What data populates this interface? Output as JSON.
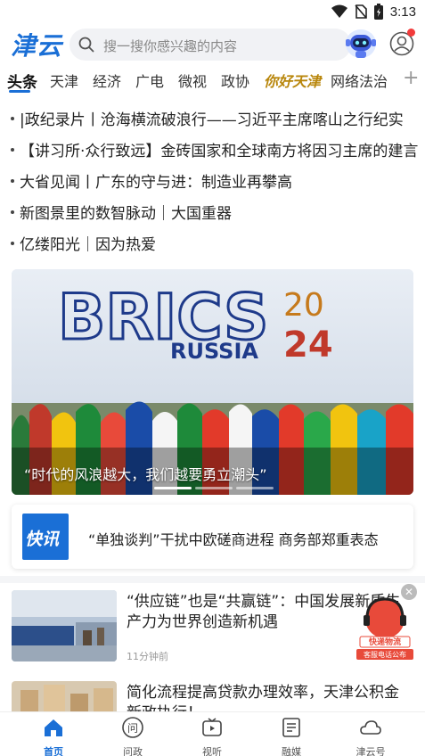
{
  "status": {
    "time": "3:13"
  },
  "header": {
    "logo": "津云",
    "search_placeholder": "搜一搜你感兴趣的内容"
  },
  "tabs": [
    {
      "label": "头条",
      "active": true
    },
    {
      "label": "天津"
    },
    {
      "label": "经济"
    },
    {
      "label": "广电"
    },
    {
      "label": "微视"
    },
    {
      "label": "政协"
    },
    {
      "label": "你好天津",
      "brand": true
    },
    {
      "label": "网络法治"
    }
  ],
  "headlines": [
    "|政纪录片丨沧海横流破浪行——习近平主席喀山之行纪实",
    "【讲习所·众行致远】金砖国家和全球南方将因习主席的建言",
    "大省见闻丨广东的守与进：制造业再攀高",
    "新图景里的数智脉动｜大国重器",
    "亿缕阳光｜因为热爱"
  ],
  "banner": {
    "caption": "“时代的风浪越大，我们越要勇立潮头”",
    "sign_brics": "BRICS",
    "sign_year_top": "20",
    "sign_year_bottom": "24",
    "sign_country": "RUSSIA"
  },
  "flash": {
    "badge": "快讯",
    "text": "“单独谈判”干扰中欧磋商进程 商务部郑重表态"
  },
  "news": [
    {
      "title": "“供应链”也是“共赢链”：中国发展新质生产力为世界创造新机遇",
      "time": "11分钟前"
    },
    {
      "title": "简化流程提高贷款办理效率，天津公积金新政执行！",
      "time": ""
    }
  ],
  "float_ad": {
    "line1": "快递物流",
    "line2": "客服电话公布"
  },
  "bottom_nav": [
    {
      "label": "首页",
      "active": true
    },
    {
      "label": "问政"
    },
    {
      "label": "视听"
    },
    {
      "label": "融媒"
    },
    {
      "label": "津云号"
    }
  ],
  "colors": {
    "accent": "#1a6fd6",
    "badge": "#1a6fd6",
    "reddot": "#f23b3b"
  }
}
